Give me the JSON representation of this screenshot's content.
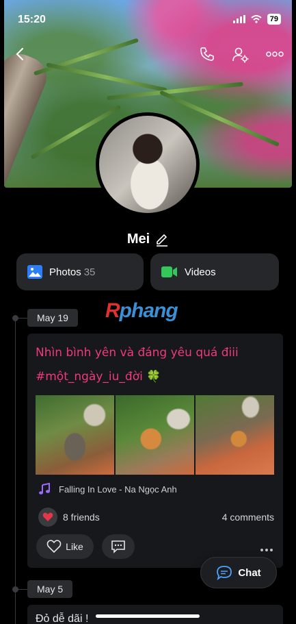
{
  "status_bar": {
    "time": "15:20",
    "battery": "79"
  },
  "profile": {
    "name": "Mei"
  },
  "tabs": {
    "photos_label": "Photos",
    "photos_count": "35",
    "videos_label": "Videos"
  },
  "watermark": {
    "prefix": "R",
    "rest": "phang"
  },
  "timeline": [
    {
      "date": "May 19",
      "text_line1": "Nhìn bình yên và đáng yêu quá điii",
      "text_line2": "#một_ngày_iu_đời 🍀",
      "music": "Falling In Love - Na Ngọc Anh",
      "reactions": "8 friends",
      "comments": "4 comments",
      "like_label": "Like"
    },
    {
      "date": "May 5",
      "text": "Đỏ dễ dãi !"
    }
  ],
  "chat_button": {
    "label": "Chat"
  },
  "colors": {
    "accent_pink": "#f03a7a",
    "photos_icon": "#2d7ff9",
    "videos_icon": "#34c759",
    "heart": "#e5364a",
    "chat_icon": "#4aa3ff"
  }
}
